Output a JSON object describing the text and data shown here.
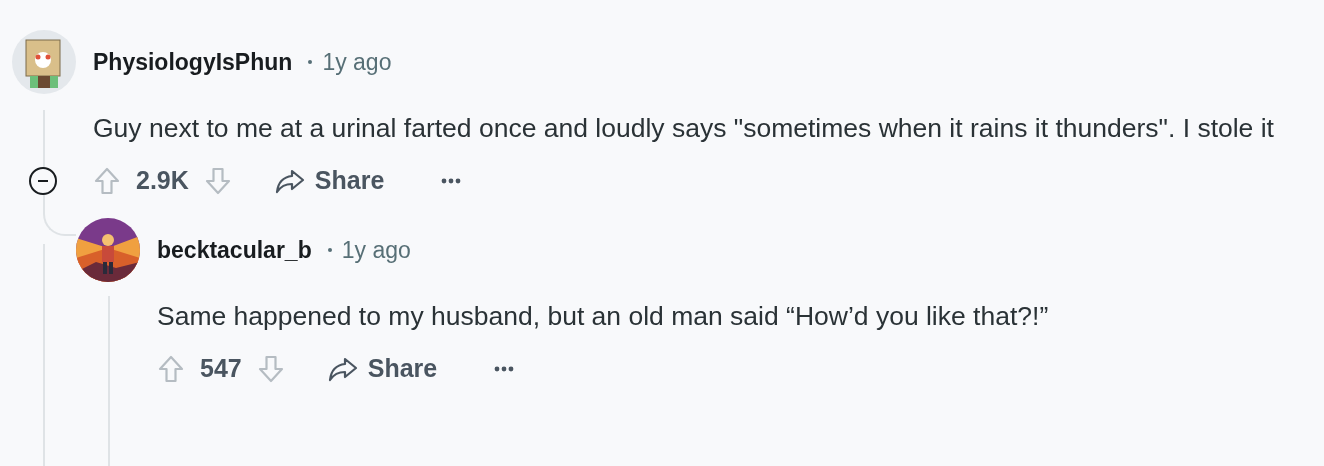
{
  "comments": [
    {
      "username": "PhysiologyIsPhun",
      "time": "1y ago",
      "body": "Guy next to me at a urinal farted once and loudly says \"sometimes when it rains it thunders\". I stole it",
      "score": "2.9K",
      "share": "Share",
      "expanded": true,
      "replies": [
        {
          "username": "becktacular_b",
          "time": "1y ago",
          "body": "Same happened to my husband, but an old man said “How’d you like that?!”",
          "score": "547",
          "share": "Share"
        }
      ]
    }
  ]
}
